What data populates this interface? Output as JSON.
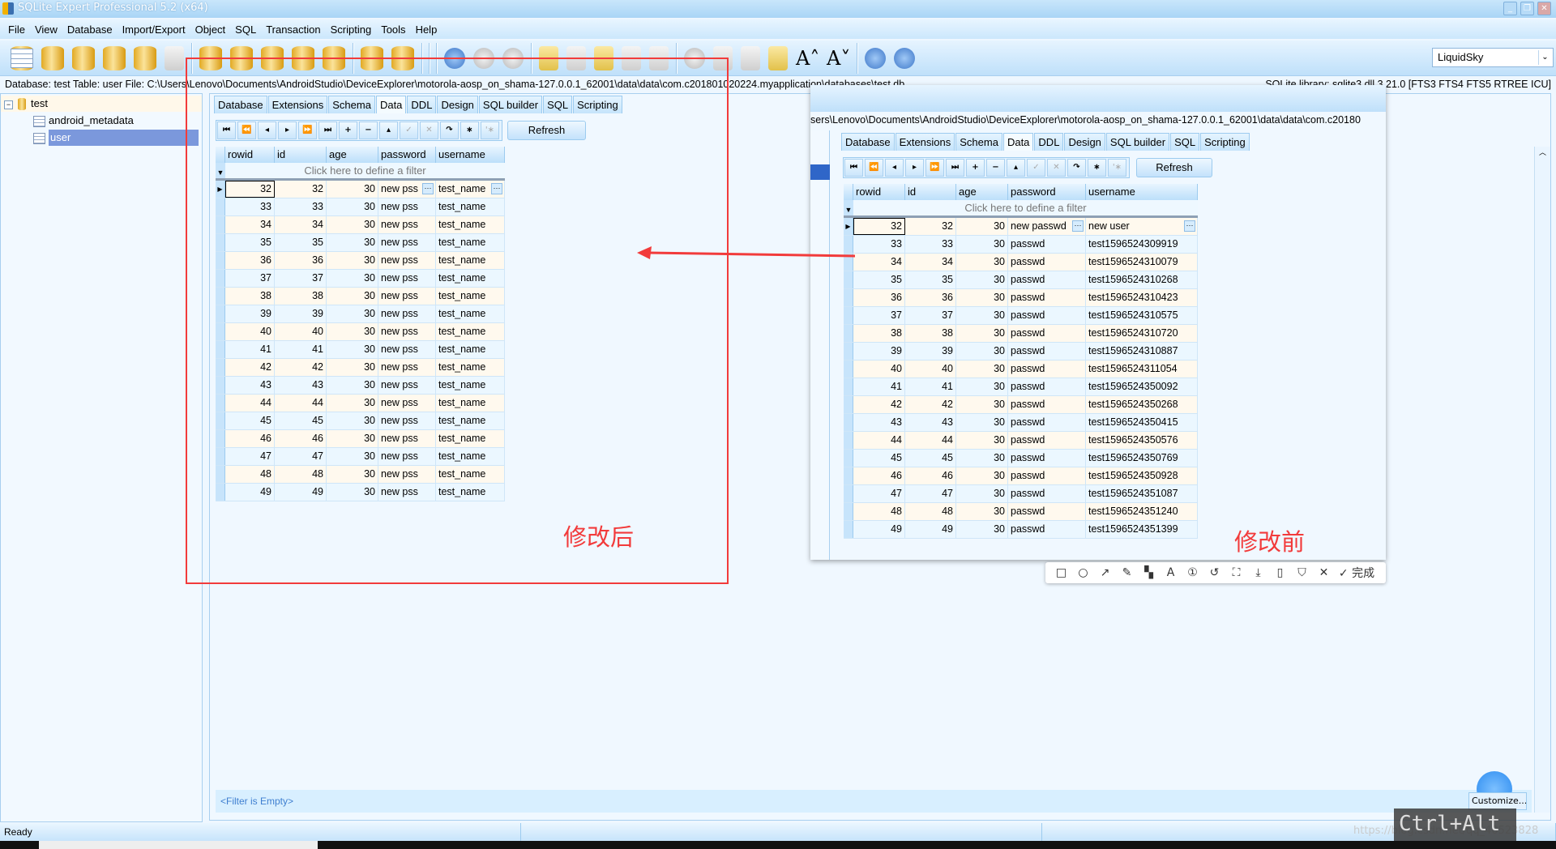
{
  "window": {
    "title": "SQLite Expert Professional 5.2 (x64)"
  },
  "menu": [
    "File",
    "View",
    "Database",
    "Import/Export",
    "Object",
    "SQL",
    "Transaction",
    "Scripting",
    "Tools",
    "Help"
  ],
  "toolbar": {
    "icons": [
      "new-database",
      "open-database",
      "attach-database",
      "detach-database",
      "rename",
      "compact-database",
      "function",
      "exit",
      "refresh-database",
      "check-database",
      "database-security",
      "design-table",
      "repair",
      "backup",
      "compare",
      "import",
      "new-table",
      "edit-table",
      "new-view",
      "sql-log",
      "commit",
      "rollback",
      "execute",
      "execute-step",
      "stop",
      "new-script",
      "edit-script",
      "run-script",
      "save-script",
      "save-script-as",
      "settings",
      "copy",
      "paste",
      "chart",
      "increase-font",
      "decrease-font",
      "help",
      "update",
      "about"
    ],
    "theme": "LiquidSky"
  },
  "infobar": {
    "text": "Database: test   Table: user   File: C:\\Users\\Lenovo\\Documents\\AndroidStudio\\DeviceExplorer\\motorola-aosp_on_shama-127.0.0.1_62001\\data\\data\\com.c201801020224.myapplication\\databases\\test.db",
    "library": "SQLite library: sqlite3.dll 3.21.0 [FTS3 FTS4 FTS5 RTREE ICU]"
  },
  "tree": {
    "database": "test",
    "tables": [
      "android_metadata",
      "user"
    ],
    "selected": "user"
  },
  "tabs": [
    "Database",
    "Extensions",
    "Schema",
    "Data",
    "DDL",
    "Design",
    "SQL builder",
    "SQL",
    "Scripting"
  ],
  "active_tab": "Data",
  "nav_buttons": [
    "⏮",
    "⏪",
    "◂",
    "▸",
    "⏩",
    "⏭",
    "+",
    "−",
    "▴",
    "✓",
    "✕",
    "↷",
    "∗",
    "'∗"
  ],
  "refresh_label": "Refresh",
  "columns": [
    "rowid",
    "id",
    "age",
    "password",
    "username"
  ],
  "filter_hint": "Click here to define a filter",
  "after": {
    "label": "修改后",
    "rows": [
      [
        "32",
        "32",
        "30",
        "new pss",
        "test_name"
      ],
      [
        "33",
        "33",
        "30",
        "new pss",
        "test_name"
      ],
      [
        "34",
        "34",
        "30",
        "new pss",
        "test_name"
      ],
      [
        "35",
        "35",
        "30",
        "new pss",
        "test_name"
      ],
      [
        "36",
        "36",
        "30",
        "new pss",
        "test_name"
      ],
      [
        "37",
        "37",
        "30",
        "new pss",
        "test_name"
      ],
      [
        "38",
        "38",
        "30",
        "new pss",
        "test_name"
      ],
      [
        "39",
        "39",
        "30",
        "new pss",
        "test_name"
      ],
      [
        "40",
        "40",
        "30",
        "new pss",
        "test_name"
      ],
      [
        "41",
        "41",
        "30",
        "new pss",
        "test_name"
      ],
      [
        "42",
        "42",
        "30",
        "new pss",
        "test_name"
      ],
      [
        "43",
        "43",
        "30",
        "new pss",
        "test_name"
      ],
      [
        "44",
        "44",
        "30",
        "new pss",
        "test_name"
      ],
      [
        "45",
        "45",
        "30",
        "new pss",
        "test_name"
      ],
      [
        "46",
        "46",
        "30",
        "new pss",
        "test_name"
      ],
      [
        "47",
        "47",
        "30",
        "new pss",
        "test_name"
      ],
      [
        "48",
        "48",
        "30",
        "new pss",
        "test_name"
      ],
      [
        "49",
        "49",
        "30",
        "new pss",
        "test_name"
      ]
    ]
  },
  "before": {
    "label": "修改前",
    "path": "sers\\Lenovo\\Documents\\AndroidStudio\\DeviceExplorer\\motorola-aosp_on_shama-127.0.0.1_62001\\data\\data\\com.c20180",
    "rows": [
      [
        "32",
        "32",
        "30",
        "new passwd",
        "new user"
      ],
      [
        "33",
        "33",
        "30",
        "passwd",
        "test1596524309919"
      ],
      [
        "34",
        "34",
        "30",
        "passwd",
        "test1596524310079"
      ],
      [
        "35",
        "35",
        "30",
        "passwd",
        "test1596524310268"
      ],
      [
        "36",
        "36",
        "30",
        "passwd",
        "test1596524310423"
      ],
      [
        "37",
        "37",
        "30",
        "passwd",
        "test1596524310575"
      ],
      [
        "38",
        "38",
        "30",
        "passwd",
        "test1596524310720"
      ],
      [
        "39",
        "39",
        "30",
        "passwd",
        "test1596524310887"
      ],
      [
        "40",
        "40",
        "30",
        "passwd",
        "test1596524311054"
      ],
      [
        "41",
        "41",
        "30",
        "passwd",
        "test1596524350092"
      ],
      [
        "42",
        "42",
        "30",
        "passwd",
        "test1596524350268"
      ],
      [
        "43",
        "43",
        "30",
        "passwd",
        "test1596524350415"
      ],
      [
        "44",
        "44",
        "30",
        "passwd",
        "test1596524350576"
      ],
      [
        "45",
        "45",
        "30",
        "passwd",
        "test1596524350769"
      ],
      [
        "46",
        "46",
        "30",
        "passwd",
        "test1596524350928"
      ],
      [
        "47",
        "47",
        "30",
        "passwd",
        "test1596524351087"
      ],
      [
        "48",
        "48",
        "30",
        "passwd",
        "test1596524351240"
      ],
      [
        "49",
        "49",
        "30",
        "passwd",
        "test1596524351399"
      ]
    ]
  },
  "annotation_toolbar": {
    "tools": [
      "□",
      "○",
      "↗",
      "✎",
      "▚",
      "A",
      "①",
      "↺",
      "⛶",
      "⤓",
      "▯",
      "⛉",
      "✕",
      "✓ 完成"
    ],
    "names": [
      "rectangle",
      "ellipse",
      "arrow",
      "pencil",
      "mosaic",
      "text",
      "number",
      "undo",
      "pin",
      "save",
      "phone",
      "bookmark",
      "cancel",
      "done"
    ]
  },
  "filter_status": "<Filter is Empty>",
  "customize_label": "Customize...",
  "status": "Ready",
  "shortcut_overlay": "Ctrl+Alt",
  "watermark": "https://blog.csdn.net/qq_40523828",
  "colors": {
    "annotation": "#f23b3b",
    "selection": "#7b98dc"
  }
}
